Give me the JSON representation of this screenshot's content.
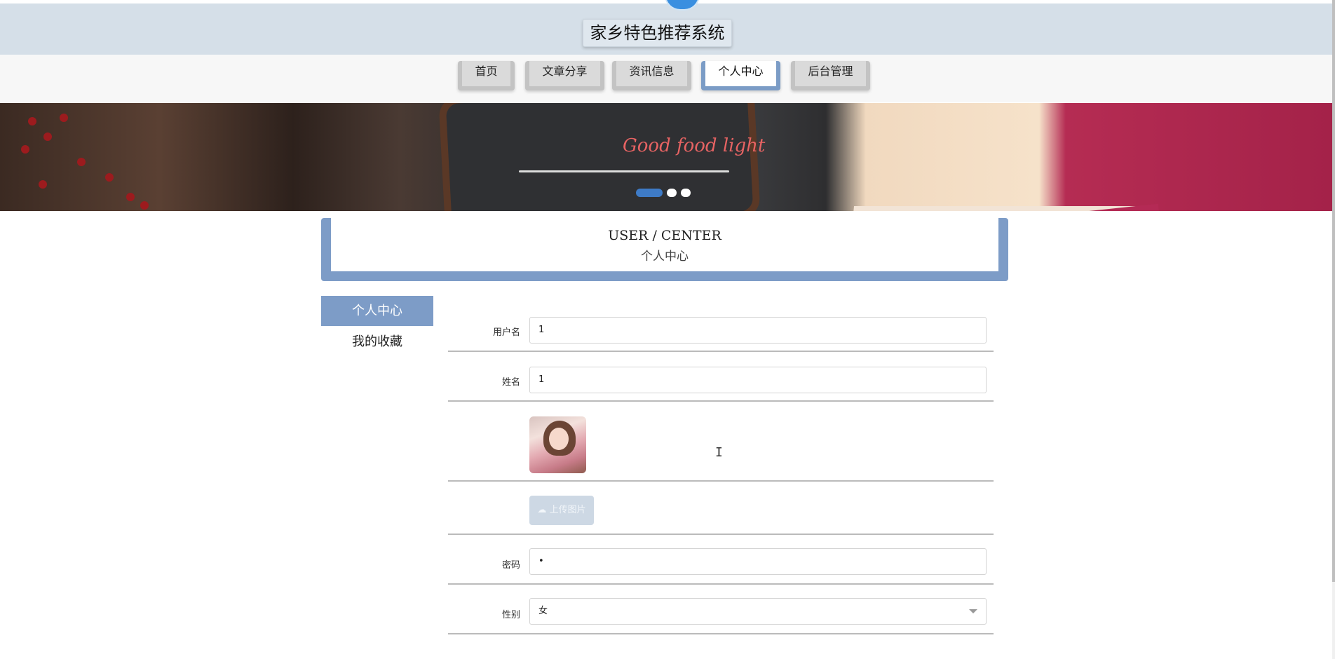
{
  "header": {
    "title": "家乡特色推荐系统"
  },
  "nav": {
    "items": [
      {
        "label": "首页",
        "active": false
      },
      {
        "label": "文章分享",
        "active": false
      },
      {
        "label": "资讯信息",
        "active": false
      },
      {
        "label": "个人中心",
        "active": true
      },
      {
        "label": "后台管理",
        "active": false
      }
    ]
  },
  "banner": {
    "slogan": "Good food light",
    "carousel_count": 3,
    "carousel_active_index": 0
  },
  "section": {
    "title_en": "USER / CENTER",
    "title_cn": "个人中心"
  },
  "sidebar": {
    "items": [
      {
        "label": "个人中心",
        "active": true
      },
      {
        "label": "我的收藏",
        "active": false
      }
    ]
  },
  "form": {
    "username": {
      "label": "用户名",
      "value": "1"
    },
    "name": {
      "label": "姓名",
      "value": "1"
    },
    "upload_button": "上传图片",
    "password": {
      "label": "密码",
      "value": "•"
    },
    "gender": {
      "label": "性别",
      "value": "女"
    }
  },
  "colors": {
    "accent": "#7d9cc7",
    "header_bg": "#d5dfe8",
    "nav_bg": "#f7f7f7"
  }
}
